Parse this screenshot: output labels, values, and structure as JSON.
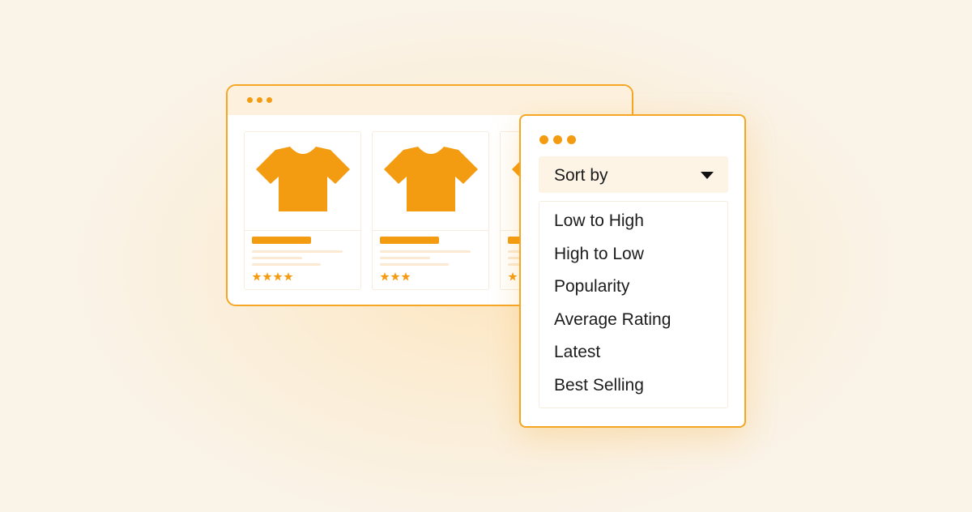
{
  "colors": {
    "accent": "#f39c12",
    "border": "#f5a623",
    "titlebar_bg": "#fdf1de",
    "dropdown_bg": "#fdf4e6"
  },
  "product_window": {
    "products": [
      {
        "icon": "tshirt-icon",
        "rating": 4
      },
      {
        "icon": "tshirt-icon",
        "rating": 3
      },
      {
        "icon": "tshirt-icon",
        "rating": 1
      }
    ]
  },
  "sort_window": {
    "sort_label": "Sort by",
    "caret_icon": "caret-down-icon",
    "options": [
      "Low to High",
      "High to Low",
      "Popularity",
      "Average Rating",
      "Latest",
      "Best Selling"
    ]
  }
}
